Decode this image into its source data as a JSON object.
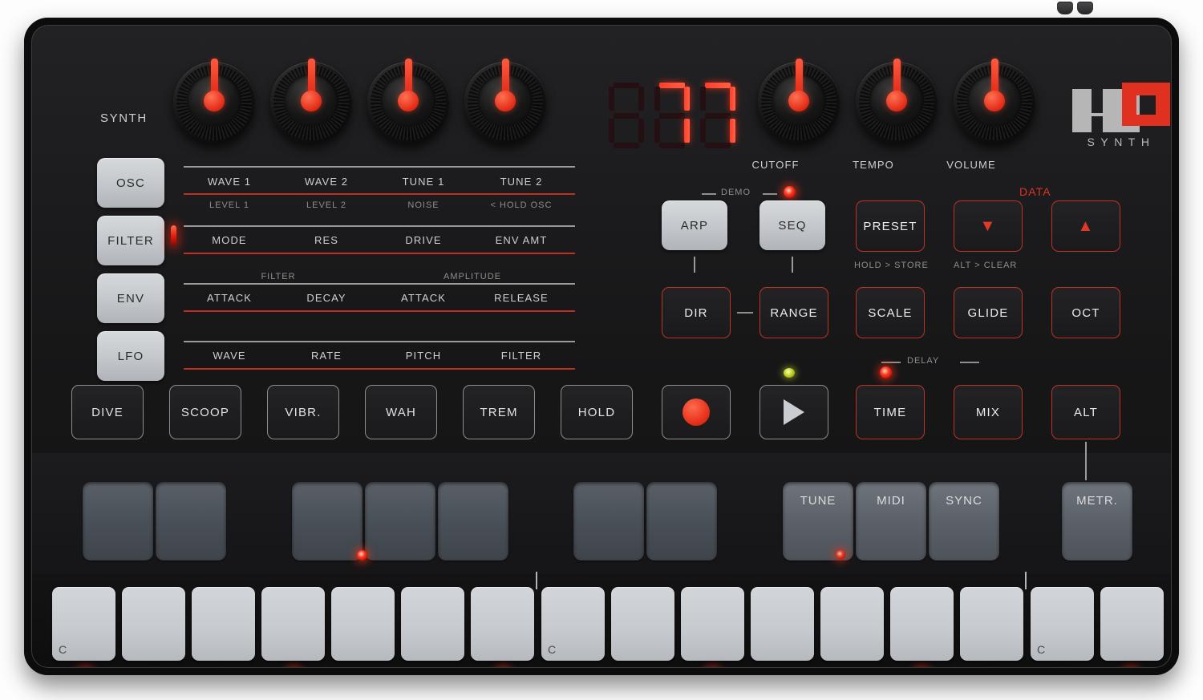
{
  "device": {
    "brand": "UNO",
    "product_word": "SYNTH",
    "section_label": "SYNTH"
  },
  "display": {
    "value": "77",
    "digits": [
      "8",
      "7",
      "7"
    ],
    "digit_active": [
      false,
      true,
      true
    ]
  },
  "knobs": {
    "left": [
      {
        "name": "wave1-knob",
        "label": "WAVE 1",
        "alt_label": "LEVEL 1"
      },
      {
        "name": "wave2-knob",
        "label": "WAVE 2",
        "alt_label": "LEVEL 2"
      },
      {
        "name": "tune1-knob",
        "label": "TUNE 1",
        "alt_label": "NOISE"
      },
      {
        "name": "tune2-knob",
        "label": "TUNE 2",
        "alt_label": "< HOLD OSC"
      }
    ],
    "right": [
      {
        "name": "cutoff-knob",
        "label": "CUTOFF"
      },
      {
        "name": "tempo-knob",
        "label": "TEMPO"
      },
      {
        "name": "volume-knob",
        "label": "VOLUME"
      }
    ]
  },
  "mode_buttons": [
    {
      "name": "osc-button",
      "label": "OSC",
      "led": "off"
    },
    {
      "name": "filter-button",
      "label": "FILTER",
      "led": "on"
    },
    {
      "name": "env-button",
      "label": "ENV",
      "led": "off"
    },
    {
      "name": "lfo-button",
      "label": "LFO",
      "led": "off"
    }
  ],
  "param_rows": [
    {
      "row": "osc",
      "params": [
        "WAVE 1",
        "WAVE 2",
        "TUNE 1",
        "TUNE 2"
      ],
      "alts": [
        "LEVEL 1",
        "LEVEL 2",
        "NOISE",
        "< HOLD OSC"
      ],
      "group_labels": []
    },
    {
      "row": "filter",
      "params": [
        "MODE",
        "RES",
        "DRIVE",
        "ENV AMT"
      ],
      "alts": [],
      "group_labels": []
    },
    {
      "row": "env",
      "params": [
        "ATTACK",
        "DECAY",
        "ATTACK",
        "RELEASE"
      ],
      "alts": [],
      "group_labels": [
        "FILTER",
        "AMPLITUDE"
      ]
    },
    {
      "row": "lfo",
      "params": [
        "WAVE",
        "RATE",
        "PITCH",
        "FILTER"
      ],
      "alts": [],
      "group_labels": []
    }
  ],
  "fx_buttons": [
    {
      "name": "dive-button",
      "label": "DIVE"
    },
    {
      "name": "scoop-button",
      "label": "SCOOP"
    },
    {
      "name": "vibr-button",
      "label": "VIBR."
    },
    {
      "name": "wah-button",
      "label": "WAH"
    },
    {
      "name": "trem-button",
      "label": "TREM"
    },
    {
      "name": "hold-button",
      "label": "HOLD"
    }
  ],
  "seq_section": {
    "demo_label": "DEMO",
    "data_label": "DATA",
    "delay_label": "DELAY",
    "arp_button": "ARP",
    "seq_button": "SEQ",
    "preset_button": "PRESET",
    "preset_sub": "HOLD > STORE",
    "data_down": "▼",
    "data_up": "▲",
    "data_sub": "ALT > CLEAR",
    "dir_button": "DIR",
    "range_button": "RANGE",
    "scale_button": "SCALE",
    "glide_button": "GLIDE",
    "oct_button": "OCT",
    "record_button": "record",
    "play_button": "play",
    "time_button": "TIME",
    "mix_button": "MIX",
    "alt_button": "ALT",
    "record_led": "yellow",
    "delay_led": "on",
    "demo_led": "on"
  },
  "pads": [
    {
      "name": "pad-1",
      "label": "",
      "pos": 0
    },
    {
      "name": "pad-2",
      "label": "",
      "pos": 1
    },
    {
      "name": "pad-3",
      "label": "",
      "pos": 3
    },
    {
      "name": "pad-4",
      "label": "",
      "pos": 4
    },
    {
      "name": "pad-5",
      "label": "",
      "pos": 5
    },
    {
      "name": "pad-6",
      "label": "",
      "pos": 7
    },
    {
      "name": "pad-7",
      "label": "",
      "pos": 8
    },
    {
      "name": "pad-tune",
      "label": "TUNE",
      "pos": 10
    },
    {
      "name": "pad-midi",
      "label": "MIDI",
      "pos": 11
    },
    {
      "name": "pad-sync",
      "label": "SYNC",
      "pos": 12
    },
    {
      "name": "pad-metr",
      "label": "METR.",
      "pos": 14
    }
  ],
  "keys": [
    {
      "num": "1",
      "note": "C",
      "led": "on"
    },
    {
      "num": "2",
      "note": "",
      "led": "mid"
    },
    {
      "num": "3",
      "note": "",
      "led": "mid"
    },
    {
      "num": "4",
      "note": "",
      "led": "on"
    },
    {
      "num": "5",
      "note": "",
      "led": "off"
    },
    {
      "num": "6",
      "note": "",
      "led": "off"
    },
    {
      "num": "7",
      "note": "",
      "led": "on"
    },
    {
      "num": "8",
      "note": "C",
      "led": "off"
    },
    {
      "num": "9",
      "note": "",
      "led": "off"
    },
    {
      "num": "10",
      "note": "",
      "led": "on"
    },
    {
      "num": "11",
      "note": "",
      "led": "off"
    },
    {
      "num": "12",
      "note": "",
      "led": "off"
    },
    {
      "num": "13",
      "note": "",
      "led": "on"
    },
    {
      "num": "14",
      "note": "",
      "led": "mid"
    },
    {
      "num": "15",
      "note": "C",
      "led": "mid"
    },
    {
      "num": "16",
      "note": "",
      "led": "on"
    }
  ],
  "colors": {
    "accent_red": "#e03127",
    "panel_black": "#161617",
    "button_gray": "#c6cacf",
    "pad_gray": "#4a5057",
    "led_red": "#ff3a1c",
    "led_yellow": "#c6d426"
  }
}
